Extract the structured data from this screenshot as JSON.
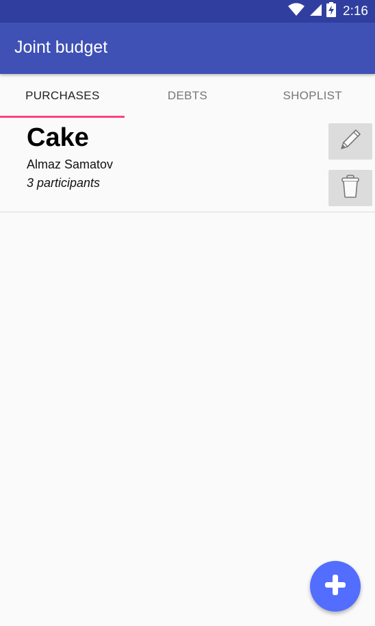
{
  "status_bar": {
    "time": "2:16",
    "icons": [
      "wifi-icon",
      "signal-icon",
      "battery-charging-icon"
    ]
  },
  "app_bar": {
    "title": "Joint budget"
  },
  "tabs": [
    {
      "label": "PURCHASES",
      "active": true
    },
    {
      "label": "DEBTS",
      "active": false
    },
    {
      "label": "SHOPLIST",
      "active": false
    }
  ],
  "purchases": [
    {
      "title": "Cake",
      "author": "Almaz Samatov",
      "participants": "3 participants",
      "actions": [
        "pencil-icon",
        "trash-icon"
      ]
    }
  ],
  "fab": {
    "icon": "plus-icon"
  },
  "colors": {
    "status_bar": "#303f9f",
    "primary": "#3f51b5",
    "accent": "#ff4081",
    "fab": "#536dfe",
    "background": "#fafafa"
  }
}
